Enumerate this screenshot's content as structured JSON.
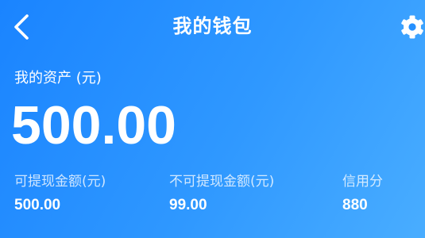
{
  "header": {
    "title": "我的钱包",
    "back_icon": "chevron-left-icon",
    "settings_icon": "gear-icon"
  },
  "assets": {
    "label": "我的资产 (元)",
    "value": "500.00"
  },
  "stats": [
    {
      "label": "可提现金额(元)",
      "value": "500.00"
    },
    {
      "label": "不可提现金额(元)",
      "value": "99.00"
    },
    {
      "label": "信用分",
      "value": "880"
    }
  ],
  "colors": {
    "gradient_start": "#1a84ff",
    "gradient_end": "#49adff",
    "text": "#ffffff"
  }
}
